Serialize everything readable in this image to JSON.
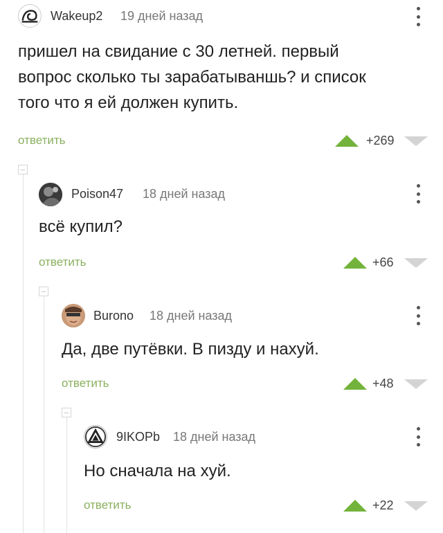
{
  "comments": [
    {
      "author": "Wakeup2",
      "time": "19 дней назад",
      "text_lines": [
        "пришел на свидание с 30 летней. первый",
        "вопрос сколько ты зарабатываншь? и список",
        "того что я ей должен купить."
      ],
      "reply_label": "ответить",
      "rating": "+269",
      "avatar_icon": "snail-avatar"
    },
    {
      "author": "Poison47",
      "time": "18 дней назад",
      "text_lines": [
        "всё купил?"
      ],
      "reply_label": "ответить",
      "rating": "+66",
      "avatar_icon": "photo-avatar"
    },
    {
      "author": "Burono",
      "time": "18 дней назад",
      "text_lines": [
        "Да, две путёвки. В пизду и нахуй."
      ],
      "reply_label": "ответить",
      "rating": "+48",
      "avatar_icon": "face-avatar"
    },
    {
      "author": "9IKOPb",
      "time": "18 дней назад",
      "text_lines": [
        "Но сначала на хуй."
      ],
      "reply_label": "ответить",
      "rating": "+22",
      "avatar_icon": "triangle-logo-avatar"
    }
  ],
  "colors": {
    "reply_link": "#8ab05f",
    "upvote": "#73b33b",
    "downvote": "#d4d4d4",
    "branch_line": "#e1e1e1"
  }
}
